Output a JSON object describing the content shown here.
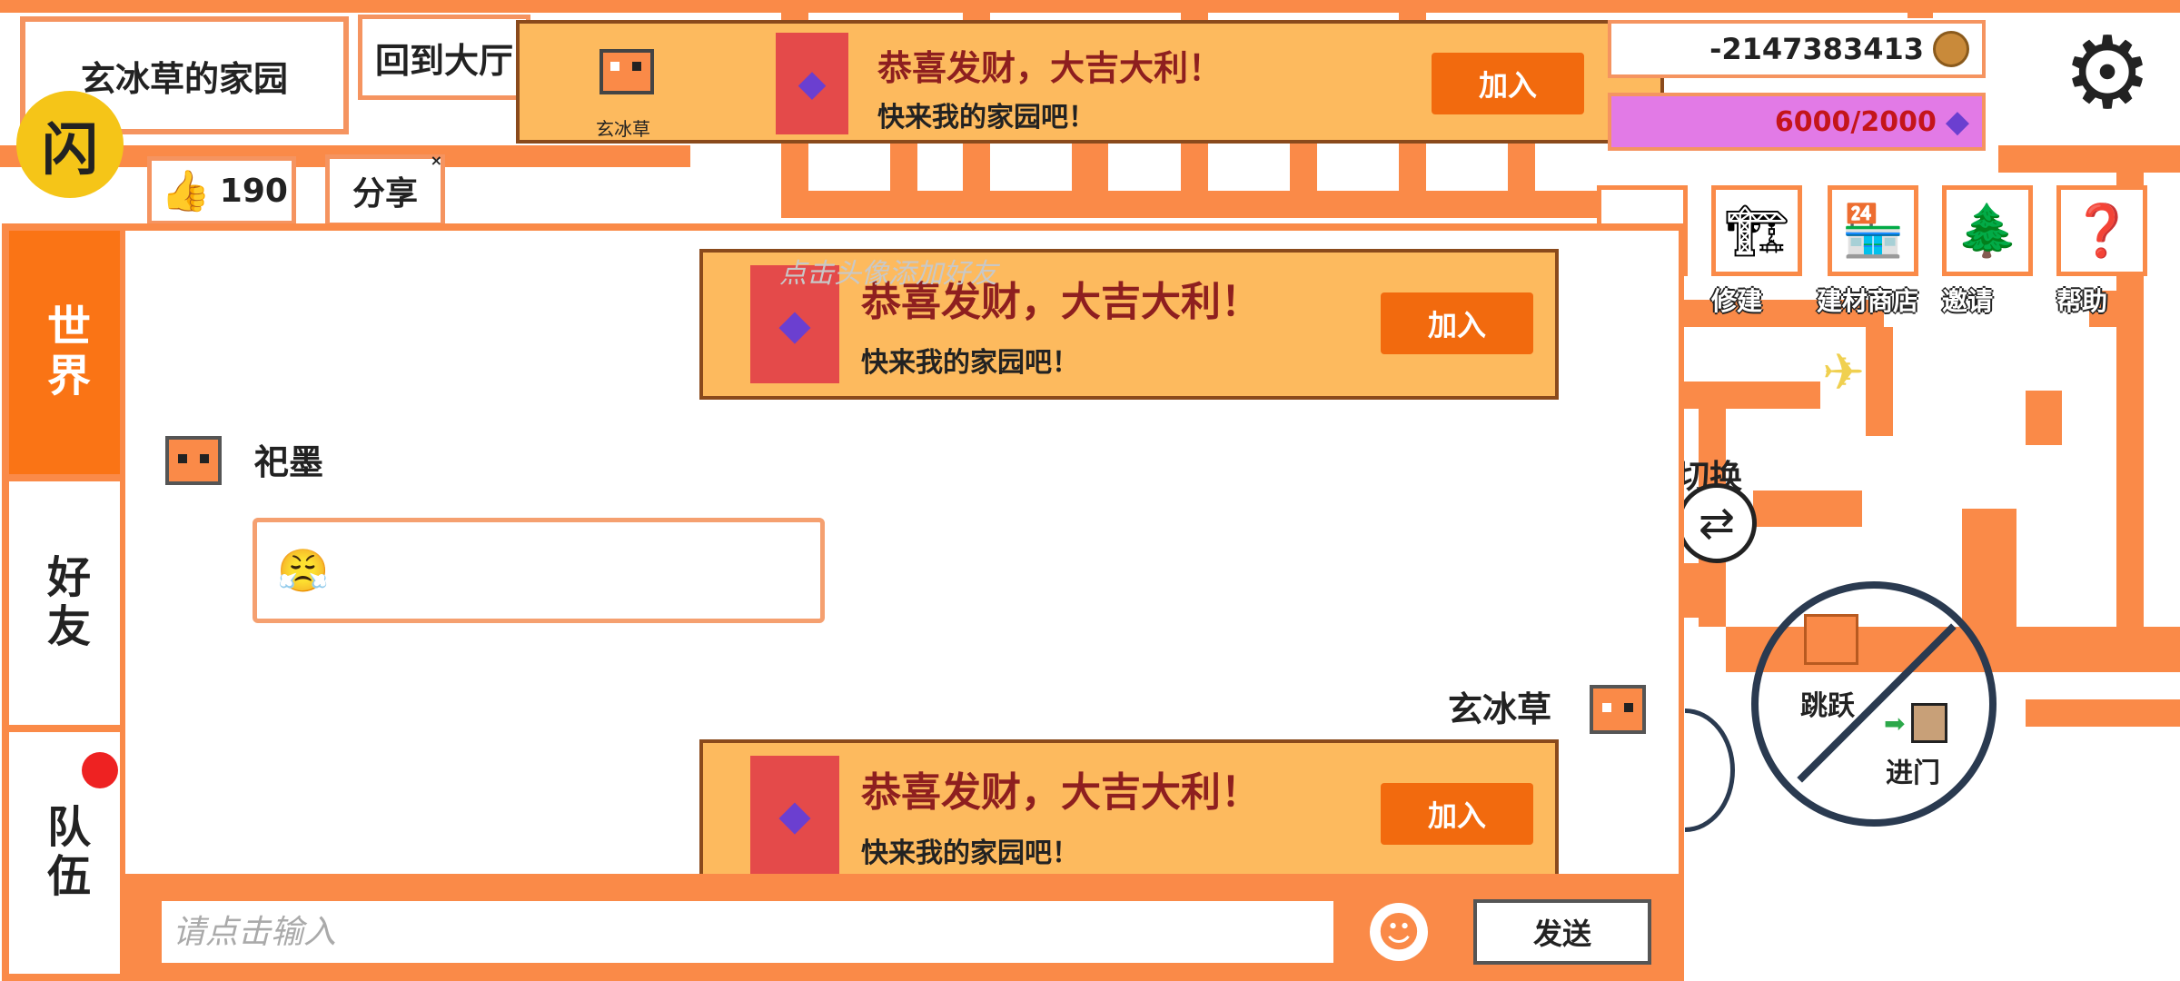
{
  "hud": {
    "garden_title": "玄冰草的家园",
    "back_to_hall": "回到大厅",
    "app_badge_char": "闪",
    "likes_count": "190",
    "share_label": "分享",
    "share_close": "×",
    "coins": "-2147383413",
    "gems": "6000/2000",
    "settings_glyph": "⚙"
  },
  "top_banner": {
    "player_name": "玄冰草",
    "title": "恭喜发财，大吉大利！",
    "subtitle": "快来我的家园吧！",
    "join_label": "加入",
    "gem_glyph": "◆"
  },
  "right_menu": [
    {
      "label": "修建",
      "icon": "🏗"
    },
    {
      "label": "建材商店",
      "icon": "🏪"
    },
    {
      "label": "邀请",
      "icon": "🌲"
    },
    {
      "label": "帮助",
      "icon": "❓"
    }
  ],
  "controls": {
    "switch_label": "切换",
    "switch_glyph": "⇄",
    "jump_label": "跳跃",
    "enter_label": "进门",
    "arrow_glyph": "➡",
    "plane_glyph": "✈"
  },
  "chat": {
    "tabs": [
      "世界",
      "好友",
      "队伍"
    ],
    "active_tab": "世界",
    "ghost_hint": "点击头像添加好友",
    "messages": [
      {
        "sender": "",
        "title": "恭喜发财，大吉大利！",
        "subtitle": "快来我的家园吧！",
        "join_label": "加入"
      },
      {
        "sender": "祀墨",
        "emoji": "😤"
      },
      {
        "sender": "玄冰草",
        "title": "恭喜发财，大吉大利！",
        "subtitle": "快来我的家园吧！",
        "join_label": "加入"
      }
    ],
    "input_placeholder": "请点击输入",
    "emoji_glyph": "☻",
    "send_label": "发送"
  },
  "colors": {
    "maze_orange": "#fa8a48",
    "active_tab": "#fa7415",
    "banner_bg": "#fdba5e",
    "join_button": "#f26a0e",
    "title_red": "#8e1f1f",
    "gem_bar": "#e27ae6"
  }
}
